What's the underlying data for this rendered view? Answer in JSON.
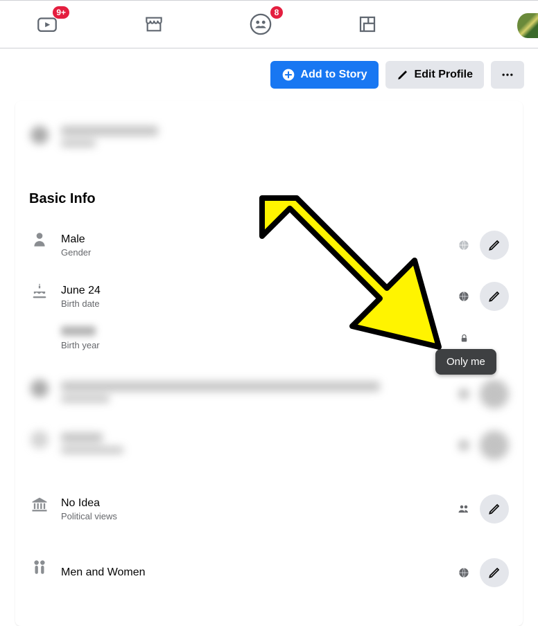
{
  "topnav": {
    "watch_badge": "9+",
    "groups_badge": "8"
  },
  "actions": {
    "add_to_story": "Add to Story",
    "edit_profile": "Edit Profile"
  },
  "section_title": "Basic Info",
  "rows": {
    "gender": {
      "value": "Male",
      "label": "Gender"
    },
    "birth_date": {
      "value": "June 24",
      "label": "Birth date"
    },
    "birth_year": {
      "label": "Birth year"
    },
    "political": {
      "value": "No Idea",
      "label": "Political views"
    },
    "interested": {
      "value": "Men and Women"
    }
  },
  "tooltip": "Only me"
}
